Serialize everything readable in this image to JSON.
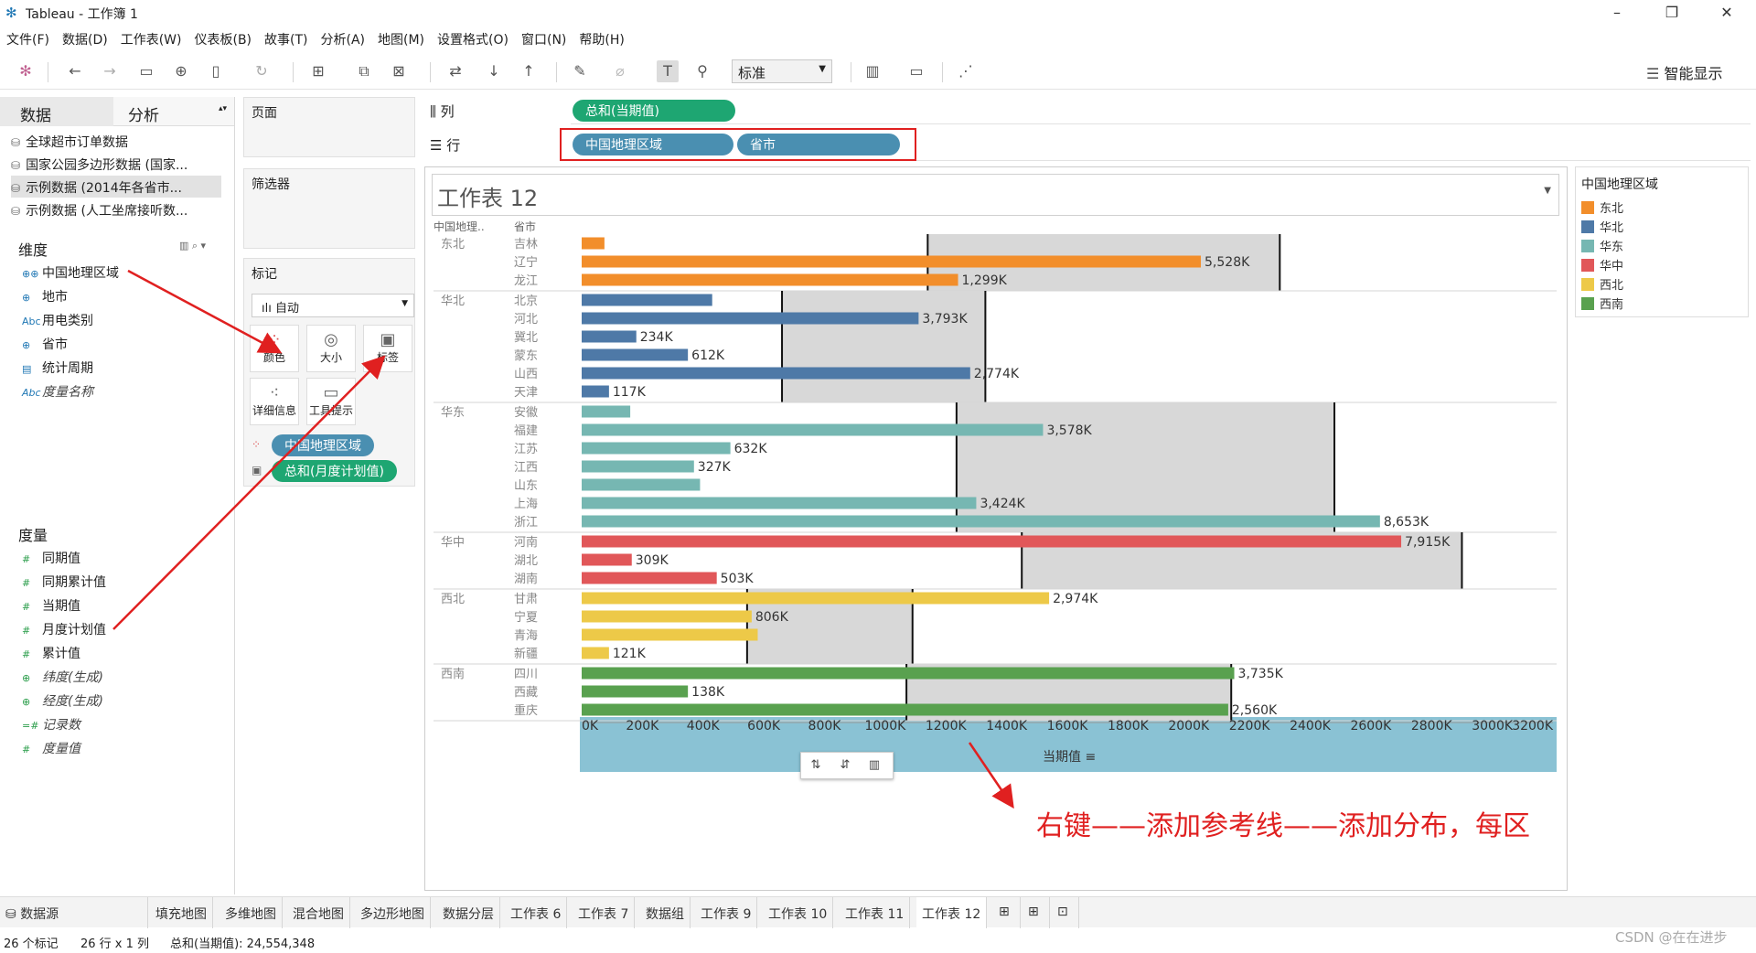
{
  "window": {
    "title": "Tableau - 工作簿 1"
  },
  "menu": [
    "文件(F)",
    "数据(D)",
    "工作表(W)",
    "仪表板(B)",
    "故事(T)",
    "分析(A)",
    "地图(M)",
    "设置格式(O)",
    "窗口(N)",
    "帮助(H)"
  ],
  "toolbar": {
    "fit_value": "标准",
    "show_me": "智能显示"
  },
  "data_pane": {
    "tab_data": "数据",
    "tab_analysis": "分析",
    "sources": [
      "全球超市订单数据",
      "国家公园多边形数据 (国家...",
      "示例数据 (2014年各省市...",
      "示例数据 (人工坐席接听数..."
    ],
    "dimensions_label": "维度",
    "dimensions": [
      "中国地理区域",
      "地市",
      "用电类别",
      "省市",
      "统计周期",
      "度量名称"
    ],
    "measures_label": "度量",
    "measures": [
      "同期值",
      "同期累计值",
      "当期值",
      "月度计划值",
      "累计值",
      "纬度(生成)",
      "经度(生成)",
      "记录数",
      "度量值"
    ]
  },
  "cards": {
    "pages": "页面",
    "filters": "筛选器",
    "marks": "标记",
    "mark_type": "自动",
    "buttons": [
      "颜色",
      "大小",
      "标签",
      "详细信息",
      "工具提示"
    ],
    "pills": [
      "中国地理区域",
      "总和(月度计划值)"
    ]
  },
  "shelves": {
    "columns_label": "列",
    "rows_label": "行",
    "columns": [
      "总和(当期值)"
    ],
    "rows": [
      "中国地理区域",
      "省市"
    ]
  },
  "view": {
    "title": "工作表 12",
    "col_header_1": "中国地理..",
    "col_header_2": "省市",
    "axis_title": "当期值",
    "annotation": "右键——添加参考线——添加分布，每区"
  },
  "legend": {
    "title": "中国地理区域",
    "items": [
      {
        "name": "东北",
        "color": "#f28e2b"
      },
      {
        "name": "华北",
        "color": "#4e79a7"
      },
      {
        "name": "华东",
        "color": "#76b7b2"
      },
      {
        "name": "华中",
        "color": "#e15759"
      },
      {
        "name": "西北",
        "color": "#edc948"
      },
      {
        "name": "西南",
        "color": "#59a14f"
      }
    ]
  },
  "chart_data": {
    "type": "bar",
    "orientation": "horizontal",
    "xlabel": "当期值",
    "xlim": [
      0,
      3200000
    ],
    "x_ticks": [
      "0K",
      "200K",
      "400K",
      "600K",
      "800K",
      "1000K",
      "1200K",
      "1400K",
      "1600K",
      "1800K",
      "2000K",
      "2200K",
      "2400K",
      "2600K",
      "2800K",
      "3000K",
      "3200K"
    ],
    "groups": [
      {
        "region": "东北",
        "color": "#f28e2b",
        "band": [
          1140000,
          2300000
        ],
        "items": [
          {
            "name": "吉林",
            "value": 75000,
            "label": ""
          },
          {
            "name": "辽宁",
            "value": 2040000,
            "label": "5,528K"
          },
          {
            "name": "龙江",
            "value": 1240000,
            "label": "1,299K"
          }
        ]
      },
      {
        "region": "华北",
        "color": "#4e79a7",
        "band": [
          660000,
          1330000
        ],
        "items": [
          {
            "name": "北京",
            "value": 430000,
            "label": ""
          },
          {
            "name": "河北",
            "value": 1110000,
            "label": "3,793K"
          },
          {
            "name": "冀北",
            "value": 180000,
            "label": "234K"
          },
          {
            "name": "蒙东",
            "value": 350000,
            "label": "612K"
          },
          {
            "name": "山西",
            "value": 1280000,
            "label": "2,774K"
          },
          {
            "name": "天津",
            "value": 90000,
            "label": "117K"
          }
        ]
      },
      {
        "region": "华东",
        "color": "#76b7b2",
        "band": [
          1235000,
          2480000
        ],
        "items": [
          {
            "name": "安徽",
            "value": 160000,
            "label": ""
          },
          {
            "name": "福建",
            "value": 1520000,
            "label": "3,578K"
          },
          {
            "name": "江苏",
            "value": 490000,
            "label": "632K"
          },
          {
            "name": "江西",
            "value": 370000,
            "label": "327K"
          },
          {
            "name": "山东",
            "value": 390000,
            "label": ""
          },
          {
            "name": "上海",
            "value": 1300000,
            "label": "3,424K"
          },
          {
            "name": "浙江",
            "value": 2630000,
            "label": "8,653K"
          }
        ]
      },
      {
        "region": "华中",
        "color": "#e15759",
        "band": [
          1450000,
          2900000
        ],
        "items": [
          {
            "name": "河南",
            "value": 2700000,
            "label": "7,915K"
          },
          {
            "name": "湖北",
            "value": 165000,
            "label": "309K"
          },
          {
            "name": "湖南",
            "value": 445000,
            "label": "503K"
          }
        ]
      },
      {
        "region": "西北",
        "color": "#edc948",
        "band": [
          545000,
          1090000
        ],
        "items": [
          {
            "name": "甘肃",
            "value": 1540000,
            "label": "2,974K"
          },
          {
            "name": "宁夏",
            "value": 560000,
            "label": "806K"
          },
          {
            "name": "青海",
            "value": 580000,
            "label": ""
          },
          {
            "name": "新疆",
            "value": 90000,
            "label": "121K"
          }
        ]
      },
      {
        "region": "西南",
        "color": "#59a14f",
        "band": [
          1070000,
          2140000
        ],
        "items": [
          {
            "name": "四川",
            "value": 2150000,
            "label": "3,735K"
          },
          {
            "name": "西藏",
            "value": 350000,
            "label": "138K"
          },
          {
            "name": "重庆",
            "value": 2130000,
            "label": "2,560K"
          }
        ]
      }
    ]
  },
  "sheet_tabs": {
    "datasource": "数据源",
    "tabs": [
      "填充地图",
      "多维地图",
      "混合地图",
      "多边形地图",
      "数据分层",
      "工作表 6",
      "工作表 7",
      "数据组",
      "工作表 9",
      "工作表 10",
      "工作表 11",
      "工作表 12"
    ],
    "active": "工作表 12"
  },
  "status": {
    "marks": "26 个标记",
    "rows_cols": "26 行 x 1 列",
    "sum": "总和(当期值): 24,554,348"
  },
  "watermark": "CSDN @在在进步"
}
